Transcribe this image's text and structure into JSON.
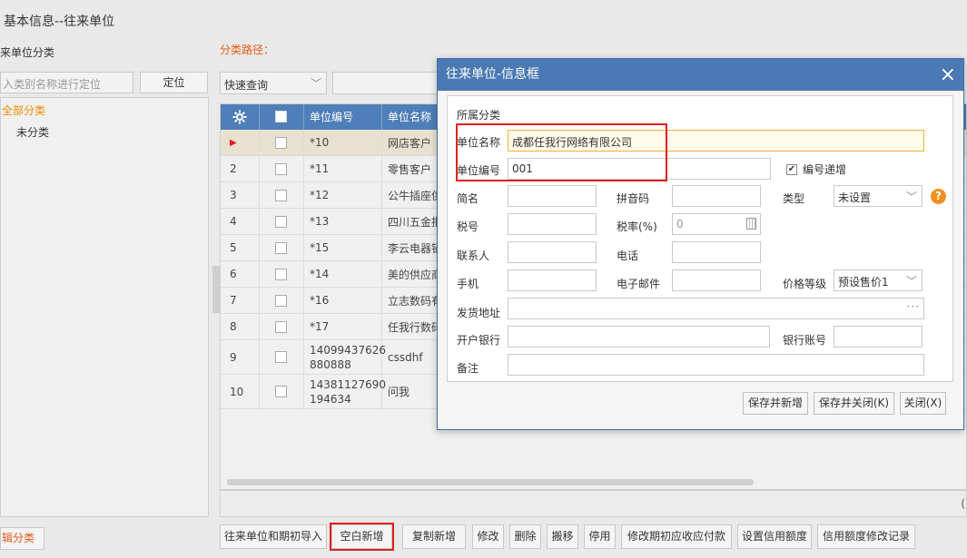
{
  "page": {
    "title": "基本信息--往来单位"
  },
  "left_panel": {
    "heading": "来单位分类",
    "search_placeholder": "入类别名称进行定位",
    "locate_label": "定位",
    "tree": [
      {
        "label": "全部分类",
        "color": "#f08c00"
      },
      {
        "label": "未分类"
      }
    ],
    "edit_category_label": "辑分类"
  },
  "toolbar": {
    "path_label": "分类路径：",
    "quick_query_value": "快速查询"
  },
  "grid": {
    "columns": [
      "",
      "",
      "单位编号",
      "单位名称"
    ],
    "rows": [
      {
        "num": "",
        "code": "*10",
        "name": "网店客户",
        "selected": true
      },
      {
        "num": "2",
        "code": "*11",
        "name": "零售客户"
      },
      {
        "num": "3",
        "code": "*12",
        "name": "公牛插座供"
      },
      {
        "num": "4",
        "code": "*13",
        "name": "四川五金批"
      },
      {
        "num": "5",
        "code": "*15",
        "name": "李云电器销"
      },
      {
        "num": "6",
        "code": "*14",
        "name": "美的供应商"
      },
      {
        "num": "7",
        "code": "*16",
        "name": "立志数码有"
      },
      {
        "num": "8",
        "code": "*17",
        "name": "任我行数码"
      },
      {
        "num": "9",
        "code": "14099437626\n880888",
        "name": "cssdhf"
      },
      {
        "num": "10",
        "code": "14381127690\n194634",
        "name": "问我"
      }
    ]
  },
  "status": {
    "paren": "("
  },
  "bottom_buttons": [
    "往来单位和期初导入",
    "空白新增",
    "复制新增",
    "修改",
    "删除",
    "搬移",
    "停用",
    "修改期初应收应付款",
    "设置信用额度",
    "信用额度修改记录"
  ],
  "dialog": {
    "title": "往来单位-信息框",
    "close_icon": "×",
    "category_label": "所属分类",
    "name_label": "单位名称",
    "name_value": "成都任我行网络有限公司",
    "code_label": "单位编号",
    "code_value": "001",
    "auto_increment_label": "编号递增",
    "auto_increment_checked": true,
    "short_label": "简名",
    "pinyin_label": "拼音码",
    "type_label": "类型",
    "type_value": "未设置",
    "tax_no_label": "税号",
    "tax_rate_label": "税率(%)",
    "tax_rate_value": "0",
    "contact_label": "联系人",
    "phone_label": "电话",
    "mobile_label": "手机",
    "email_label": "电子邮件",
    "price_level_label": "价格等级",
    "price_level_value": "预设售价1",
    "address_label": "发货地址",
    "address_dots": "···",
    "bank_label": "开户银行",
    "bank_account_label": "银行账号",
    "remark_label": "备注",
    "save_new_label": "保存并新增",
    "save_close_label": "保存并关闭(K)",
    "close_label": "关闭(X)",
    "help_icon": "?"
  }
}
